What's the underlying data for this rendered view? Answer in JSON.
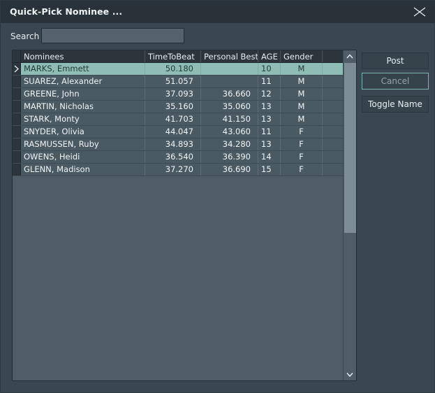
{
  "window": {
    "title": "Quick-Pick Nominee ...",
    "close_icon": "close-icon",
    "background": "#3a4750",
    "titlebar_background": "#283238"
  },
  "search": {
    "label": "Search",
    "value": "",
    "placeholder": ""
  },
  "grid": {
    "columns": [
      {
        "key": "name",
        "label": "Nominees"
      },
      {
        "key": "ttb",
        "label": "TimeToBeat"
      },
      {
        "key": "pb",
        "label": "Personal Best"
      },
      {
        "key": "age",
        "label": "AGE"
      },
      {
        "key": "gender",
        "label": "Gender"
      }
    ],
    "selected_row_index": 0,
    "selected_row_color": "#8fbdb5",
    "row_marker_icon": "chevron-right-icon",
    "rows": [
      {
        "name": "MARKS, Emmett",
        "ttb": "50.180",
        "pb": "",
        "age": "10",
        "gender": "M"
      },
      {
        "name": "SUAREZ, Alexander",
        "ttb": "51.057",
        "pb": "",
        "age": "11",
        "gender": "M"
      },
      {
        "name": "GREENE, John",
        "ttb": "37.093",
        "pb": "36.660",
        "age": "12",
        "gender": "M"
      },
      {
        "name": "MARTIN, Nicholas",
        "ttb": "35.160",
        "pb": "35.060",
        "age": "13",
        "gender": "M"
      },
      {
        "name": "STARK, Monty",
        "ttb": "41.703",
        "pb": "41.150",
        "age": "13",
        "gender": "M"
      },
      {
        "name": "SNYDER, Olivia",
        "ttb": "44.047",
        "pb": "43.060",
        "age": "11",
        "gender": "F"
      },
      {
        "name": "RASMUSSEN, Ruby",
        "ttb": "34.893",
        "pb": "34.280",
        "age": "13",
        "gender": "F"
      },
      {
        "name": "OWENS, Heidi",
        "ttb": "36.540",
        "pb": "36.390",
        "age": "14",
        "gender": "F"
      },
      {
        "name": "GLENN, Madison",
        "ttb": "37.270",
        "pb": "36.690",
        "age": "15",
        "gender": "F"
      }
    ]
  },
  "scrollbar": {
    "up_icon": "chevron-up-icon",
    "down_icon": "chevron-down-icon"
  },
  "buttons": {
    "post": "Post",
    "cancel": "Cancel",
    "toggle_name": "Toggle Name",
    "focus_color": "#79b3ab"
  }
}
